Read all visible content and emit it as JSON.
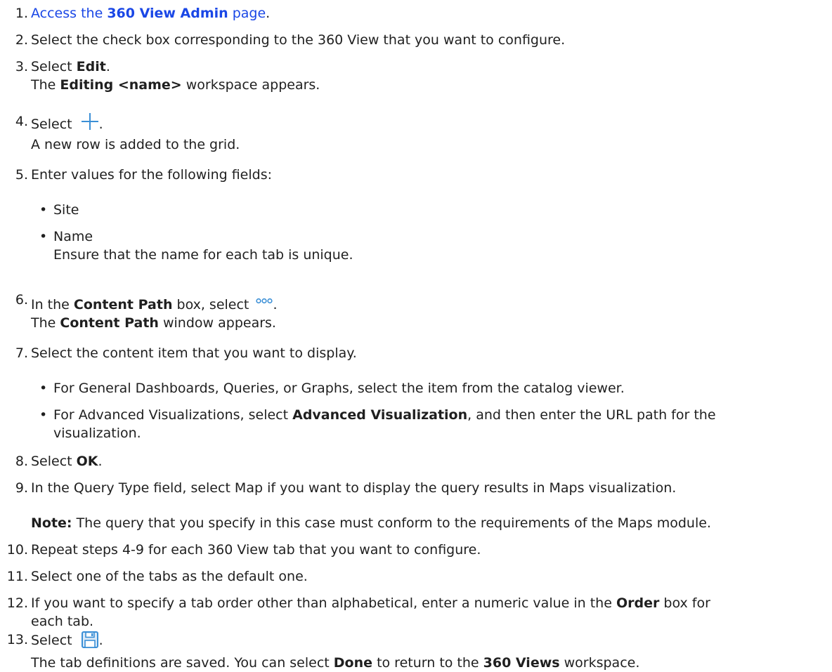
{
  "steps": [
    {
      "num": "1.",
      "pre": "Access the ",
      "link_bold": "360 View Admin",
      "link_post": " page",
      "post": "."
    },
    {
      "num": "2.",
      "text": "Select the check box corresponding to the 360 View that you want to configure."
    },
    {
      "num": "3.",
      "pre": "Select ",
      "bold": "Edit",
      "post": ".",
      "result_pre": "The ",
      "result_bold": "Editing <name>",
      "result_post": " workspace appears."
    },
    {
      "num": "4.",
      "pre": "Select ",
      "icon": "plus-icon",
      "post": ".",
      "result": "A new row is added to the grid."
    },
    {
      "num": "5.",
      "text": "Enter values for the following fields:",
      "bullets": [
        "Site",
        "Name"
      ],
      "bullet_note": "Ensure that the name for each tab is unique."
    },
    {
      "num": "6.",
      "pre": "In the ",
      "bold": "Content Path",
      "mid": " box, select ",
      "icon": "more-dots-icon",
      "post": ".",
      "result_pre": "The ",
      "result_bold": "Content Path",
      "result_post": " window appears."
    },
    {
      "num": "7.",
      "text": "Select the content item that you want to display.",
      "bullet1": "For General Dashboards, Queries, or Graphs, select the item from the catalog viewer.",
      "bullet2_pre": "For Advanced Visualizations, select ",
      "bullet2_bold": "Advanced Visualization",
      "bullet2_post": ", and then enter the URL path for the",
      "bullet2_cont": "visualization."
    },
    {
      "num": "8.",
      "pre": "Select ",
      "bold": "OK",
      "post": "."
    },
    {
      "num": "9.",
      "text": "In the Query Type field, select Map if you want to display the query results in Maps visualization.",
      "note_label": "Note:",
      "note_text": " The query that you specify in this case must conform to the requirements of the Maps module."
    },
    {
      "num": "10.",
      "text": "Repeat steps 4-9 for each 360 View tab that you want to configure."
    },
    {
      "num": "11.",
      "text": "Select one of the tabs as the default one."
    },
    {
      "num": "12.",
      "pre": "If you want to specify a tab order other than alphabetical, enter a numeric value in the ",
      "bold": "Order",
      "post": " box for",
      "cont": "each tab."
    },
    {
      "num": "13.",
      "pre": "Select ",
      "icon": "save-icon",
      "post": ".",
      "result_pre": "The tab definitions are saved. You can select ",
      "result_bold": "Done",
      "result_mid": " to return to the ",
      "result_bold2": "360 Views",
      "result_post": " workspace."
    }
  ],
  "bullet_char": "•",
  "colors": {
    "link": "#1a47e6",
    "icon_blue": "#3b8fd6",
    "text": "#1f1f1f"
  }
}
